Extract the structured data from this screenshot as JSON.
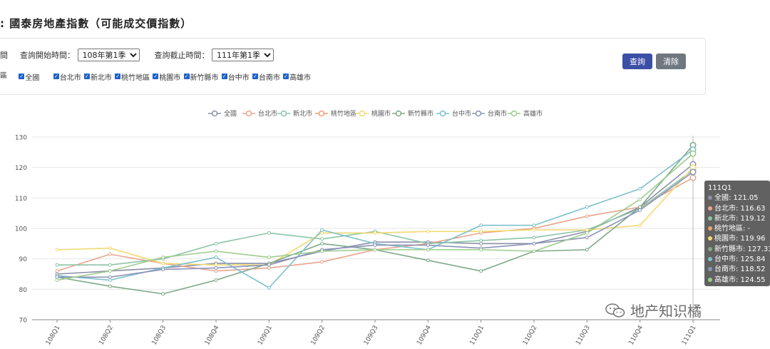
{
  "header": {
    "title": ": 國泰房地產指數（可能成交價指數）"
  },
  "filters": {
    "time_label": "間",
    "start_label": "查詢開始時間：",
    "start_value": "108年第1季",
    "end_label": "查詢截止時間：",
    "end_value": "111年第1季",
    "region_label": "區",
    "regions": [
      "全國",
      "台北市",
      "新北市",
      "桃竹地區",
      "桃園市",
      "新竹縣市",
      "台中市",
      "台南市",
      "高雄市"
    ]
  },
  "buttons": {
    "query": "查詢",
    "clear": "清除"
  },
  "tooltip": {
    "title": "111Q1",
    "rows": [
      {
        "label": "全國: 121.05",
        "color": "#8c8fa8"
      },
      {
        "label": "台北市: 116.63",
        "color": "#e8a48c"
      },
      {
        "label": "新北市: 119.12",
        "color": "#8cc4a8"
      },
      {
        "label": "桃竹地區: -",
        "color": "#f0a070"
      },
      {
        "label": "桃園市: 119.96",
        "color": "#f3d870"
      },
      {
        "label": "新竹縣市: 127.33",
        "color": "#7fa88a"
      },
      {
        "label": "台中市: 125.84",
        "color": "#7cc0cc"
      },
      {
        "label": "台南市: 118.52",
        "color": "#8a93b8"
      },
      {
        "label": "高雄市: 124.55",
        "color": "#9ccc8c"
      }
    ]
  },
  "watermark": {
    "text": "地产知识橘"
  },
  "chart_data": {
    "type": "line",
    "categories": [
      "108Q1",
      "108Q2",
      "108Q3",
      "108Q4",
      "109Q1",
      "109Q2",
      "109Q3",
      "109Q4",
      "110Q1",
      "110Q2",
      "110Q3",
      "110Q4",
      "111Q1"
    ],
    "ylim": [
      70,
      130
    ],
    "yticks": [
      70,
      80,
      90,
      100,
      110,
      120,
      130
    ],
    "grid": true,
    "legend": "top",
    "series": [
      {
        "name": "全國",
        "color": "#8c8fa8",
        "values": [
          85,
          86,
          87,
          88.5,
          88.5,
          92.5,
          95.5,
          95.5,
          95,
          95,
          99,
          107,
          121.05
        ]
      },
      {
        "name": "台北市",
        "color": "#e8a48c",
        "values": [
          86,
          91.5,
          88.5,
          86,
          87,
          89,
          93,
          95,
          98.5,
          100,
          104,
          107,
          116.63
        ]
      },
      {
        "name": "新北市",
        "color": "#8cc4a8",
        "values": [
          88,
          88,
          90,
          95,
          98.5,
          96.5,
          99,
          95,
          96,
          97,
          99.5,
          106.5,
          119.12
        ]
      },
      {
        "name": "桃竹地區",
        "color": "#f0a070",
        "values": [
          null,
          null,
          null,
          null,
          null,
          null,
          null,
          null,
          null,
          null,
          null,
          null,
          null
        ]
      },
      {
        "name": "桃園市",
        "color": "#f3d870",
        "values": [
          93,
          93.5,
          88.5,
          88,
          88,
          98.5,
          98.5,
          99,
          99,
          99.5,
          99.5,
          101,
          119.96
        ]
      },
      {
        "name": "新竹縣市",
        "color": "#7fa88a",
        "values": [
          84,
          81,
          78.5,
          83,
          88.5,
          95,
          93,
          89.5,
          86,
          92.5,
          93,
          107,
          127.33
        ]
      },
      {
        "name": "台中市",
        "color": "#7cc0cc",
        "values": [
          84.5,
          83,
          87,
          90.5,
          80.5,
          99.5,
          95,
          93,
          101,
          101,
          107,
          113,
          125.84
        ]
      },
      {
        "name": "台南市",
        "color": "#8a93b8",
        "values": [
          84,
          84,
          86.5,
          87,
          88,
          93,
          94.5,
          94.5,
          93.5,
          95,
          97,
          106,
          118.52
        ]
      },
      {
        "name": "高雄市",
        "color": "#9ccc8c",
        "values": [
          83,
          86,
          90.5,
          92.5,
          90.5,
          92.5,
          93,
          93,
          93,
          92.5,
          98.5,
          109.5,
          124.55
        ]
      }
    ]
  }
}
